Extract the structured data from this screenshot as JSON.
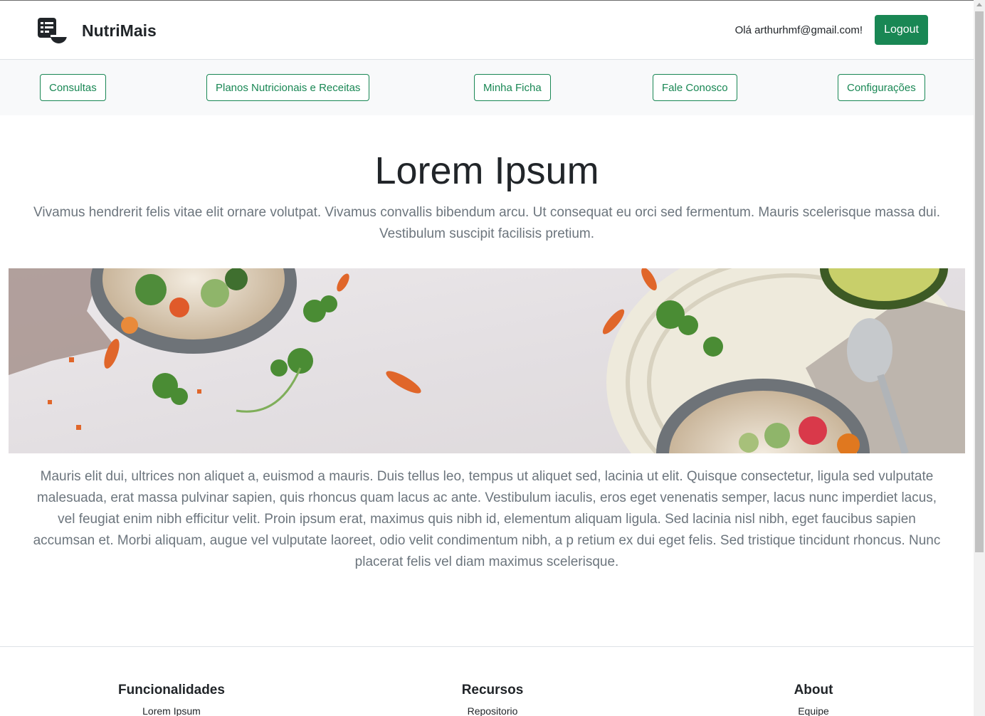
{
  "header": {
    "brand_name": "NutriMais",
    "greeting": "Olá arthurhmf@gmail.com!",
    "logout_label": "Logout"
  },
  "nav": {
    "items": [
      {
        "label": "Consultas"
      },
      {
        "label": "Planos Nutricionais e Receitas"
      },
      {
        "label": "Minha Ficha"
      },
      {
        "label": "Fale Conosco"
      },
      {
        "label": "Configurações"
      }
    ]
  },
  "hero": {
    "title": "Lorem Ipsum",
    "lead": "Vivamus hendrerit felis vitae elit ornare volutpat. Vivamus convallis bibendum arcu. Ut consequat eu orci sed fermentum. Mauris scelerisque massa dui. Vestibulum suscipit facilisis pretium."
  },
  "body": {
    "text": "Mauris elit dui, ultrices non aliquet a, euismod a mauris. Duis tellus leo, tempus ut aliquet sed, lacinia ut elit. Quisque consectetur, ligula sed vulputate malesuada, erat massa pulvinar sapien, quis rhoncus quam lacus ac ante. Vestibulum iaculis, eros eget venenatis semper, lacus nunc imperdiet lacus, vel feugiat enim nibh efficitur velit. Proin ipsum erat, maximus quis nibh id, elementum aliquam ligula. Sed lacinia nisl nibh, eget faucibus sapien accumsan et. Morbi aliquam, augue vel vulputate laoreet, odio velit condimentum nibh, a p retium ex dui eget felis. Sed tristique tincidunt rhoncus. Nunc placerat felis vel diam maximus scelerisque."
  },
  "footer": {
    "columns": [
      {
        "heading": "Funcionalidades",
        "link": "Lorem Ipsum"
      },
      {
        "heading": "Recursos",
        "link": "Repositorio"
      },
      {
        "heading": "About",
        "link": "Equipe"
      }
    ]
  },
  "colors": {
    "accent": "#198754",
    "nav_bg": "#f8f9fa",
    "muted_text": "#6c757d"
  },
  "icons": {
    "brand": "nutrition-table-bowl-icon"
  }
}
